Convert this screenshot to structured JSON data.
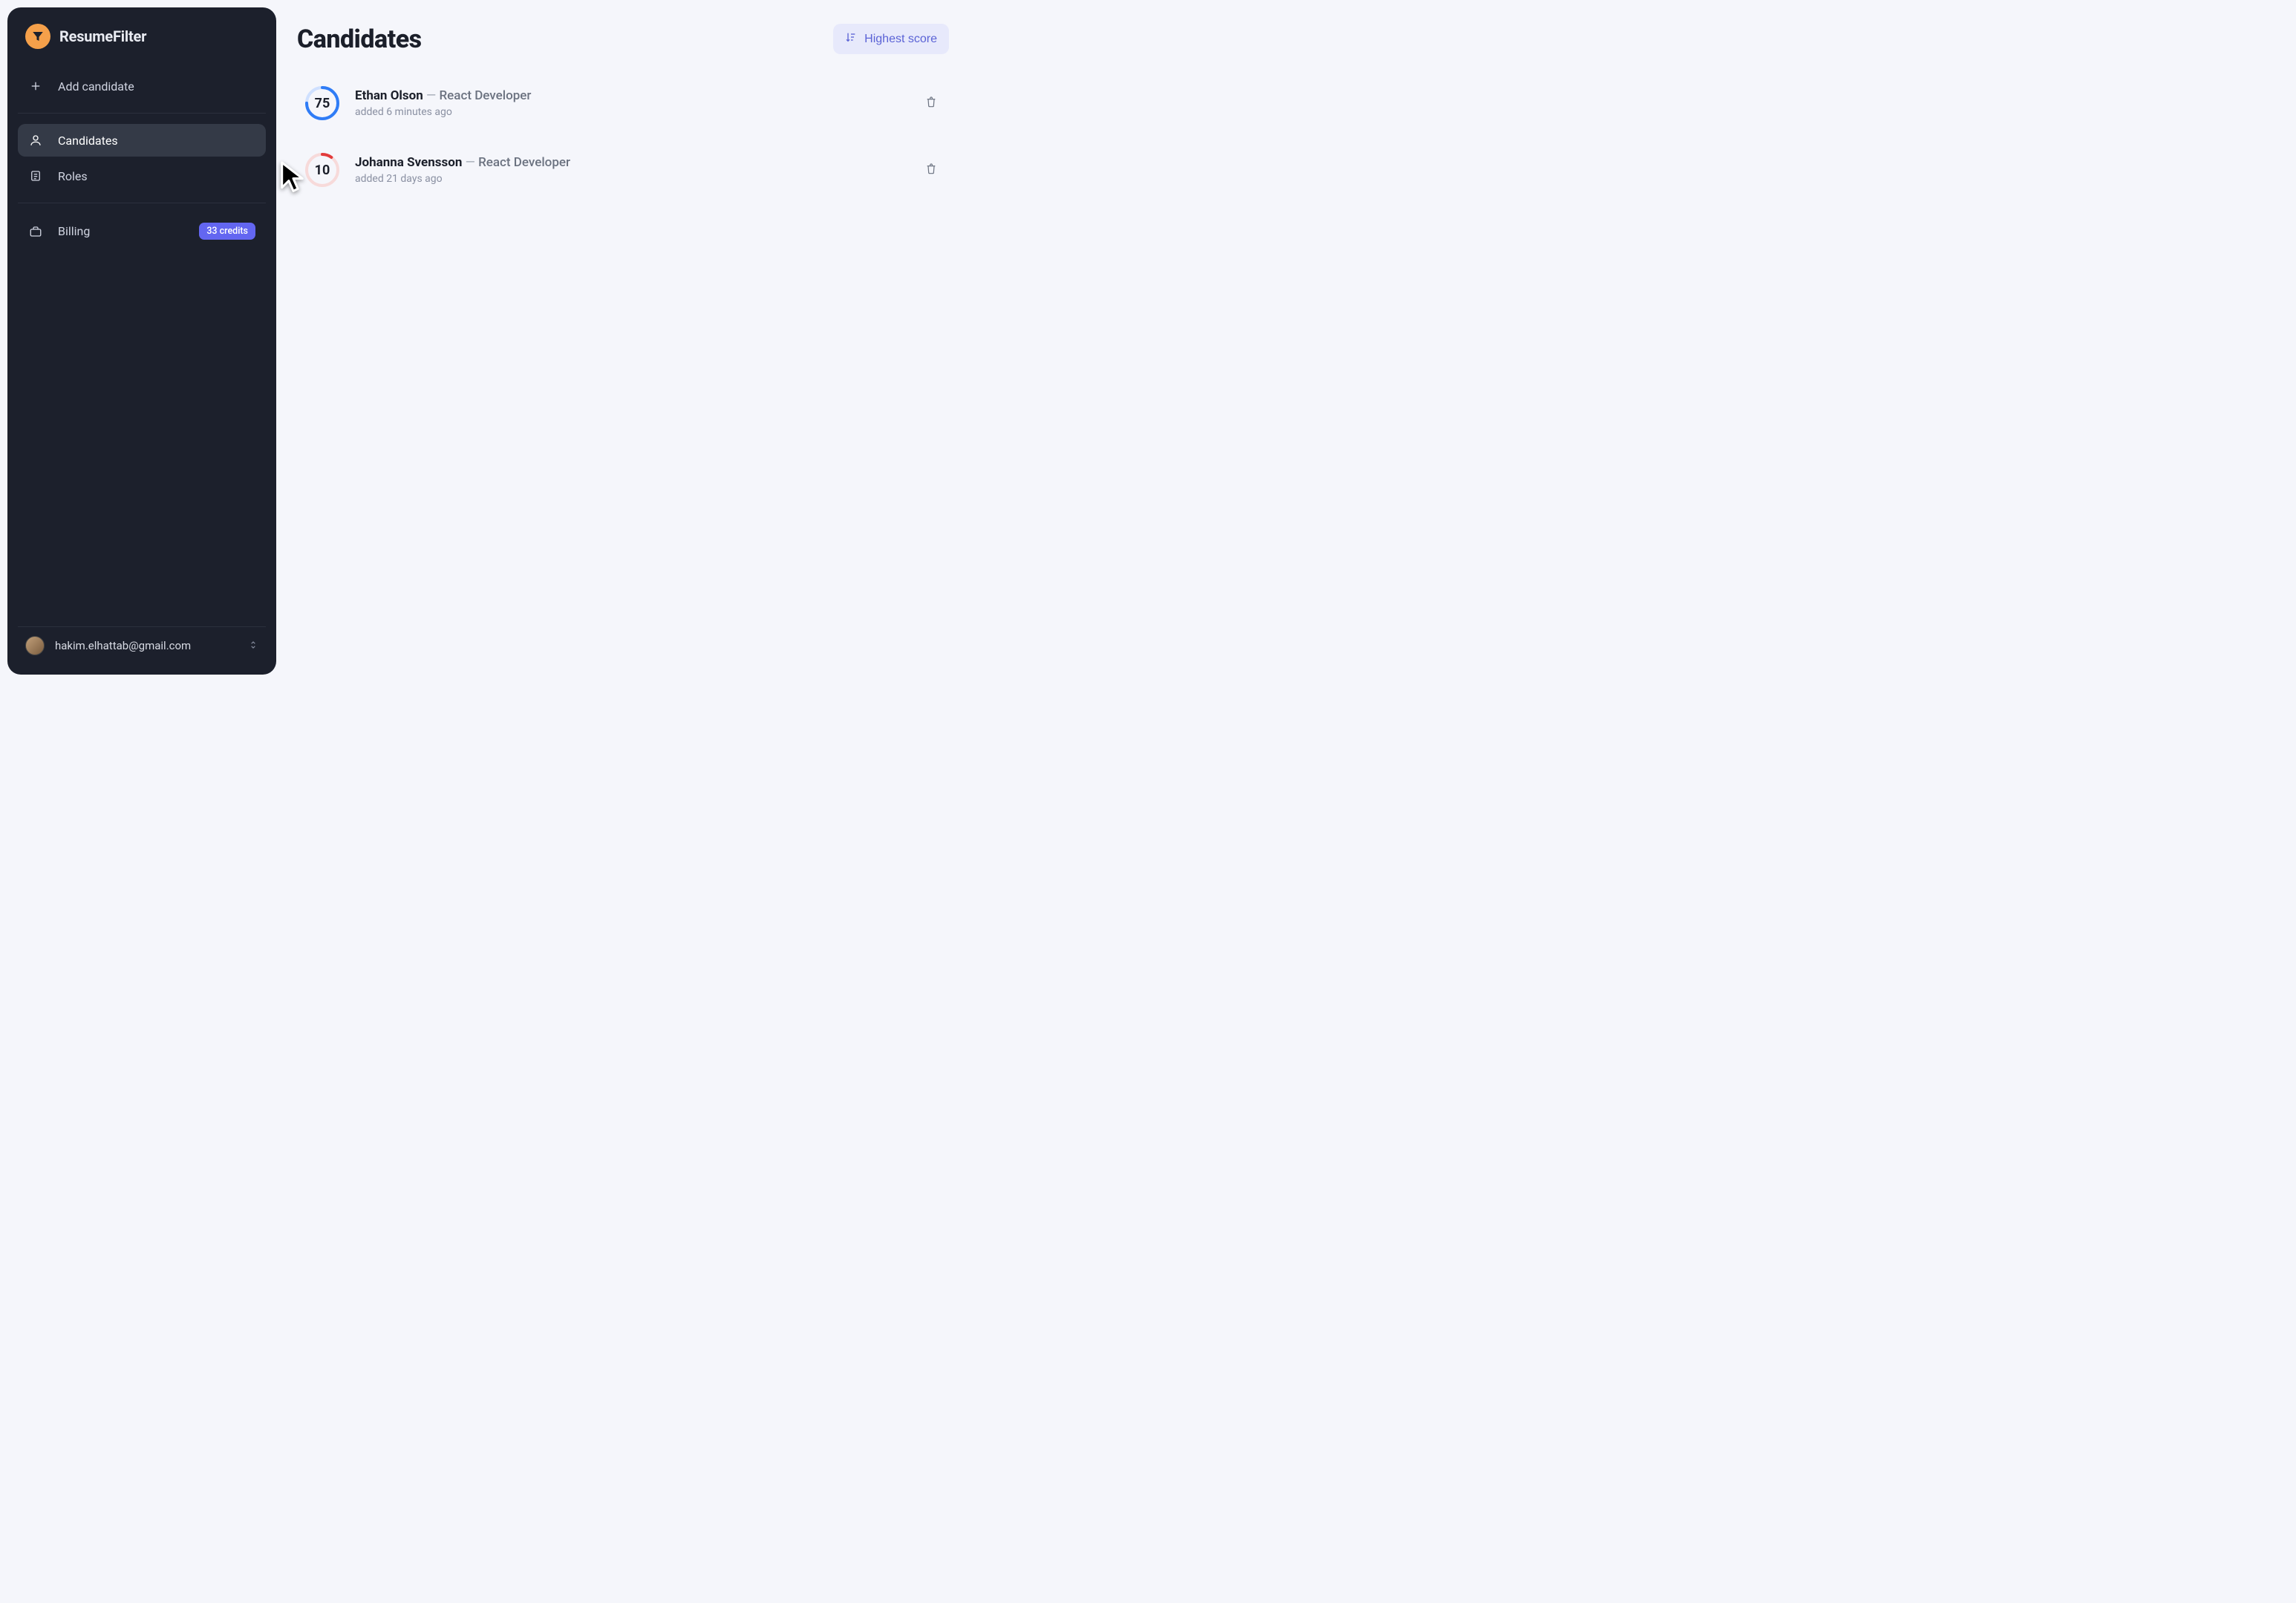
{
  "brand": {
    "name": "ResumeFilter"
  },
  "sidebar": {
    "add_label": "Add candidate",
    "items": [
      {
        "label": "Candidates"
      },
      {
        "label": "Roles"
      }
    ],
    "billing": {
      "label": "Billing",
      "badge": "33 credits"
    }
  },
  "account": {
    "email": "hakim.elhattab@gmail.com"
  },
  "main": {
    "title": "Candidates",
    "sort_label": "Highest score"
  },
  "candidates": [
    {
      "score": "75",
      "score_pct": 75,
      "score_color": "#2f7cf6",
      "score_track": "#cfe0ff",
      "name": "Ethan Olson",
      "role": "React Developer",
      "added": "added 6 minutes ago"
    },
    {
      "score": "10",
      "score_pct": 10,
      "score_color": "#e23b3b",
      "score_track": "#f7dada",
      "name": "Johanna Svensson",
      "role": "React Developer",
      "added": "added 21 days ago"
    }
  ]
}
